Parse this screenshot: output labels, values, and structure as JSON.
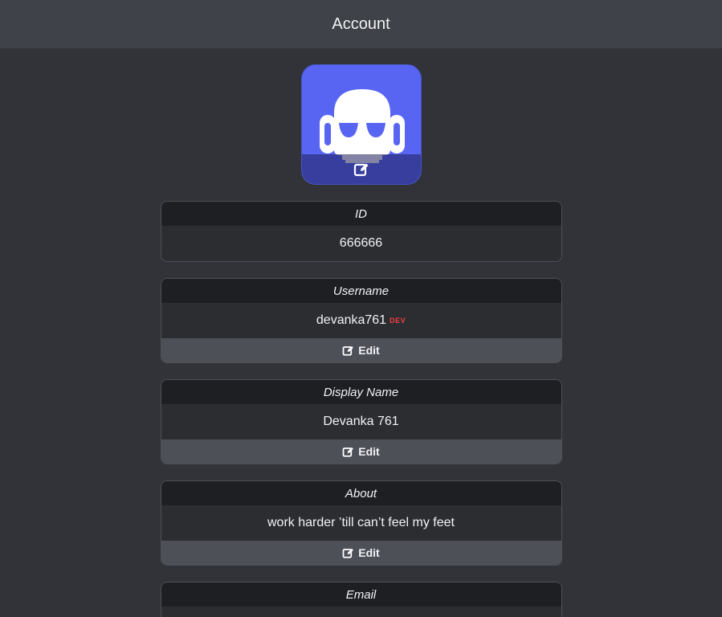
{
  "header": {
    "title": "Account"
  },
  "avatar": {
    "icon": "robot-avatar",
    "edit_icon": "edit-icon",
    "bg_color": "#5865f2"
  },
  "fields": {
    "id": {
      "label": "ID",
      "value": "666666"
    },
    "username": {
      "label": "Username",
      "value": "devanka761",
      "badge": "DEV",
      "edit_label": "Edit"
    },
    "display_name": {
      "label": "Display Name",
      "value": "Devanka 761",
      "edit_label": "Edit"
    },
    "about": {
      "label": "About",
      "value": "work harder ’till can’t feel my feet",
      "edit_label": "Edit"
    },
    "email": {
      "label": "Email"
    }
  },
  "colors": {
    "background": "#313338",
    "header": "#404249",
    "card_title": "#1e1f22",
    "edit_bar": "#4e5058",
    "badge": "#f23f43"
  }
}
